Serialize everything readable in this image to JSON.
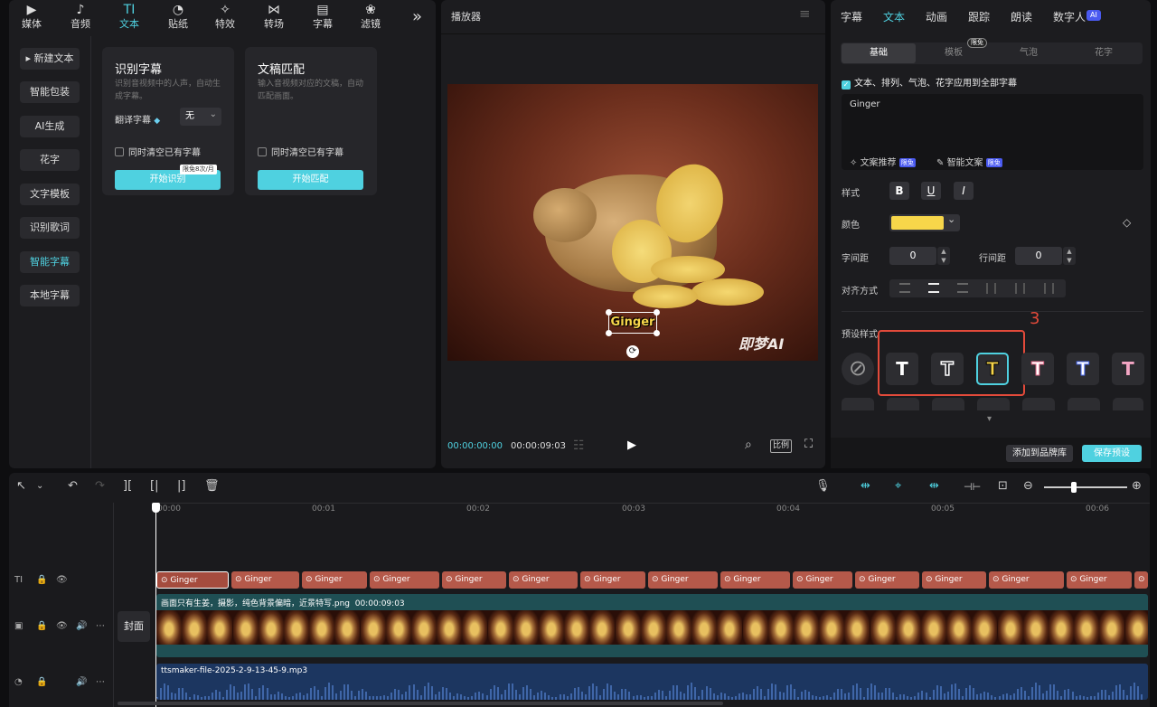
{
  "nav": {
    "items": [
      {
        "icon": "▶",
        "label": "媒体"
      },
      {
        "icon": "♪",
        "label": "音频"
      },
      {
        "icon": "TI",
        "label": "文本"
      },
      {
        "icon": "◔",
        "label": "贴纸"
      },
      {
        "icon": "✧",
        "label": "特效"
      },
      {
        "icon": "⋈",
        "label": "转场"
      },
      {
        "icon": "▤",
        "label": "字幕"
      },
      {
        "icon": "❀",
        "label": "滤镜"
      }
    ],
    "more": "»"
  },
  "sidebar": {
    "items": [
      {
        "label": "▸ 新建文本"
      },
      {
        "label": "智能包装"
      },
      {
        "label": "AI生成"
      },
      {
        "label": "花字"
      },
      {
        "label": "文字模板"
      },
      {
        "label": "识别歌词"
      },
      {
        "label": "智能字幕"
      },
      {
        "label": "本地字幕"
      }
    ]
  },
  "card1": {
    "title": "识别字幕",
    "desc": "识别音视频中的人声，自动生成字幕。",
    "translate_label": "翻译字幕",
    "translate_icon": "◆",
    "translate_value": "无",
    "dropdown_icon": "⌄",
    "clear_label": "同时清空已有字幕",
    "badge": "限免8次/月",
    "button": "开始识别"
  },
  "card2": {
    "title": "文稿匹配",
    "desc": "输入音视频对应的文稿，自动匹配画面。",
    "clear_label": "同时清空已有字幕",
    "button": "开始匹配"
  },
  "player": {
    "title": "播放器",
    "menu_icon": "≡",
    "caption": "Ginger",
    "watermark": "即梦AI",
    "time_current": "00:00:00:00",
    "time_total": "00:00:09:03",
    "grid_icon": "☷",
    "play_icon": "▶",
    "zoom_icon": "⌕",
    "ratio_label": "比例",
    "fullscreen_icon": "⛶",
    "rotate_icon": "⟳"
  },
  "right": {
    "tabs": [
      "字幕",
      "文本",
      "动画",
      "跟踪",
      "朗读",
      "数字人"
    ],
    "ai_badge": "AI",
    "subtabs": [
      "基础",
      "模板",
      "气泡",
      "花字"
    ],
    "limit_badge": "限免",
    "apply_all": "文本、排列、气泡、花字应用到全部字幕",
    "text_value": "Ginger",
    "suggest_label": "文案推荐",
    "smart_label": "智能文案",
    "free_badge": "限免",
    "style_label": "样式",
    "bold": "B",
    "underline": "U",
    "italic": "I",
    "color_label": "颜色",
    "color_value": "#f7d64a",
    "chevron": "⌄",
    "diamond": "◇",
    "char_spacing_label": "字间距",
    "char_spacing": "0",
    "line_spacing_label": "行间距",
    "line_spacing": "0",
    "align_label": "对齐方式",
    "preset_label": "预设样式",
    "annotation": "3",
    "preset_none": "⊘",
    "preset_glyph": "T",
    "down_arrow": "▾",
    "add_brand": "添加到品牌库",
    "save_preset": "保存预设"
  },
  "timeline": {
    "tools": [
      "↖",
      "⌄",
      "↶",
      "↷",
      "][",
      "[|",
      "|]",
      "🗑"
    ],
    "right_tools": [
      "🎙",
      "⇹",
      "⌖",
      "⇹",
      "⊣⊢",
      "⊡",
      "⊖",
      "⊕"
    ],
    "ticks": [
      "00:00",
      "00:01",
      "00:02",
      "00:03",
      "00:04",
      "00:05",
      "00:06"
    ],
    "text_clip": "Ginger",
    "clip_icon": "⊙",
    "video_label": "画面只有生姜，摄影，纯色背景偏暗，近景特写.png",
    "video_duration": "00:00:09:03",
    "cover_label": "封面",
    "audio_label": "ttsmaker-file-2025-2-9-13-45-9.mp3",
    "track_icons": {
      "text": "TI",
      "lock": "🔒",
      "eye": "👁",
      "video": "▣",
      "audio": "◔",
      "speaker": "🔊",
      "more": "⋯"
    }
  },
  "colors": {
    "accent": "#4fd1e0",
    "clip": "#b5594a",
    "video_track": "#1f4f54",
    "audio_track": "#1c3660",
    "annotation": "#e24a3a"
  }
}
